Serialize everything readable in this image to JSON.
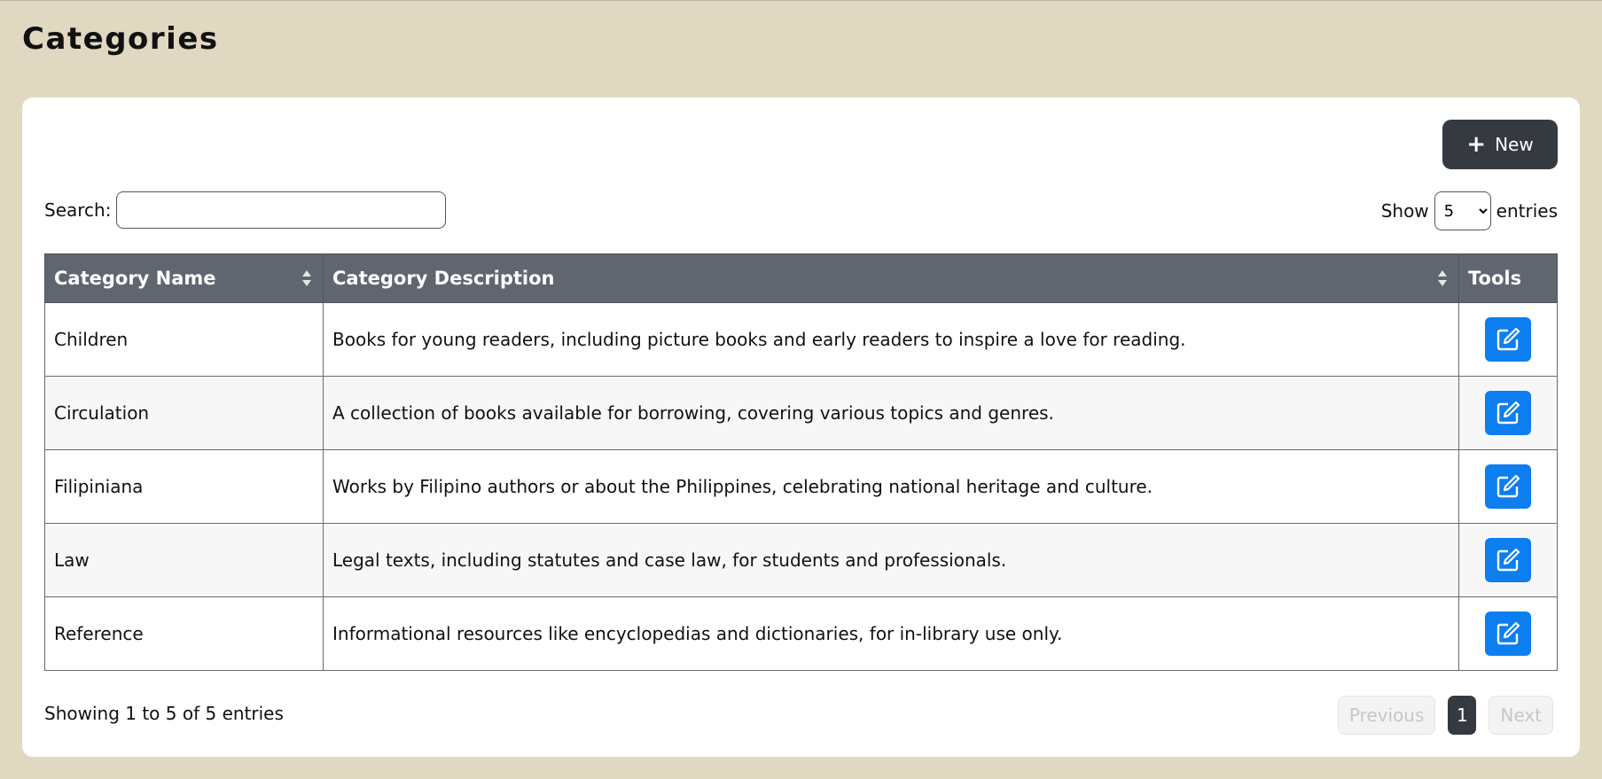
{
  "page": {
    "title": "Categories"
  },
  "toolbar": {
    "new_label": "New"
  },
  "search": {
    "label": "Search:",
    "value": "",
    "placeholder": ""
  },
  "length": {
    "show_label": "Show",
    "selected": "5",
    "entries_label": "entries"
  },
  "table": {
    "headers": {
      "name": "Category Name",
      "description": "Category Description",
      "tools": "Tools"
    },
    "rows": [
      {
        "name": "Children",
        "description": "Books for young readers, including picture books and early readers to inspire a love for reading."
      },
      {
        "name": "Circulation",
        "description": "A collection of books available for borrowing, covering various topics and genres."
      },
      {
        "name": "Filipiniana",
        "description": "Works by Filipino authors or about the Philippines, celebrating national heritage and culture."
      },
      {
        "name": "Law",
        "description": "Legal texts, including statutes and case law, for students and professionals."
      },
      {
        "name": "Reference",
        "description": "Informational resources like encyclopedias and dictionaries, for in-library use only."
      }
    ]
  },
  "footer": {
    "info": "Showing 1 to 5 of 5 entries"
  },
  "pagination": {
    "previous": "Previous",
    "current": "1",
    "next": "Next"
  },
  "icons": {
    "new": "plus-icon",
    "sort": "sort-icon",
    "edit": "edit-icon"
  },
  "colors": {
    "background": "#e0d8c0",
    "header": "#5f6670",
    "primary": "#0d7ef0",
    "dark": "#343a40"
  }
}
